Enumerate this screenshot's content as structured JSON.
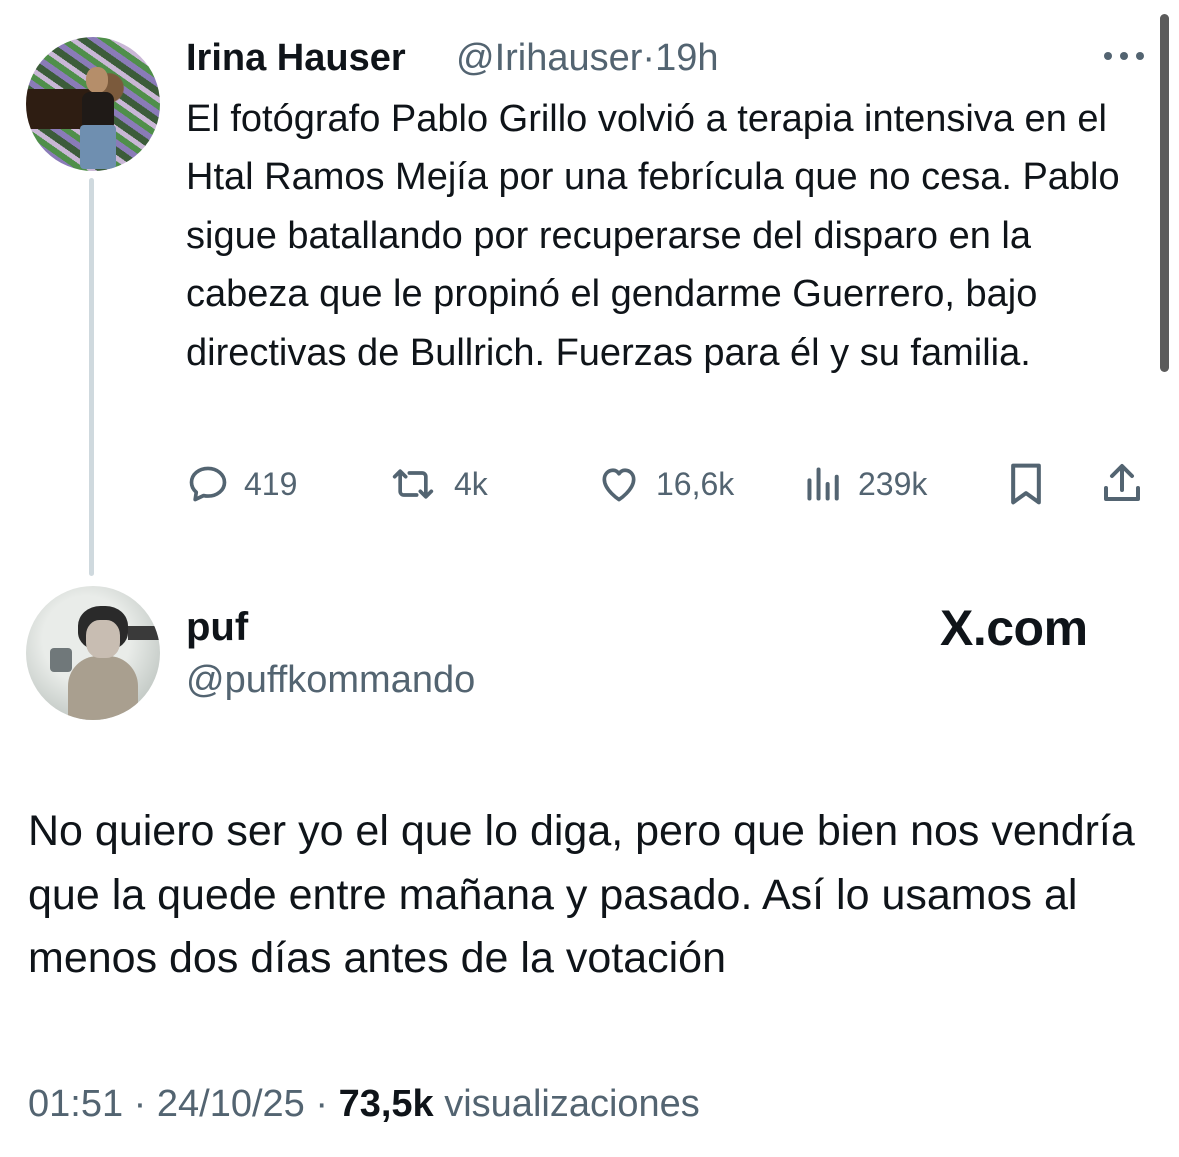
{
  "tweet": {
    "author_name": "Irina Hauser",
    "author_handle": "@Irihauser",
    "time_separator": "·",
    "time": "19h",
    "text": "El fotógrafo Pablo Grillo volvió a terapia intensiva en el Htal Ramos Mejía por una febrícula que no cesa. Pablo sigue batallando por recuperarse del disparo en la cabeza que le propinó el gendarme Guerrero, bajo directivas de Bullrich. Fuerzas para él y su familia.",
    "actions": {
      "replies": "419",
      "reposts": "4k",
      "likes": "16,6k",
      "views": "239k"
    },
    "icons": {
      "more": "more-dots-icon",
      "reply": "reply-bubble-icon",
      "repost": "repost-arrows-icon",
      "like": "heart-icon",
      "views": "views-bars-icon",
      "bookmark": "bookmark-icon",
      "share": "share-upload-icon"
    }
  },
  "reply": {
    "author_name": "puf",
    "author_handle": "@puffkommando",
    "brand": "X.com",
    "text": "No quiero ser yo el que lo diga, pero que bien nos vendría que la quede entre mañana y pasado. Así lo usamos al menos dos días antes de la votación",
    "meta": {
      "time": "01:51",
      "sep1": "·",
      "date": "24/10/25",
      "sep2": "·",
      "views_count": "73,5k",
      "views_label": "visualizaciones"
    }
  },
  "colors": {
    "text": "#0f1419",
    "secondary": "#536471",
    "thread_line": "#cfd9de",
    "background": "#ffffff"
  }
}
